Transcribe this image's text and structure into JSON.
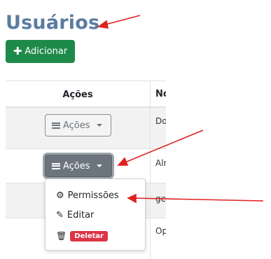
{
  "page": {
    "title": "Usuários"
  },
  "toolbar": {
    "add_icon": "plus-icon",
    "add_label": "Adicionar"
  },
  "table": {
    "headers": [
      "Ações",
      "No"
    ],
    "rows": [
      {
        "action_label": "Ações",
        "name": "Do"
      },
      {
        "action_label": "Ações",
        "name": "Alr"
      },
      {
        "action_label": "",
        "name": "ge"
      },
      {
        "action_label": "",
        "name": "Op"
      }
    ]
  },
  "dropdown": {
    "items": [
      {
        "icon": "gear-icon",
        "label": "Permissões"
      },
      {
        "icon": "edit-icon",
        "label": "Editar"
      },
      {
        "icon": "trash-icon",
        "label": "Deletar"
      }
    ]
  },
  "colors": {
    "title": "#5a7ca0",
    "add_button": "#1e8a4a",
    "dark_button": "#6c757d",
    "delete_badge": "#dc3545",
    "annotation_arrow": "#e0201f"
  }
}
